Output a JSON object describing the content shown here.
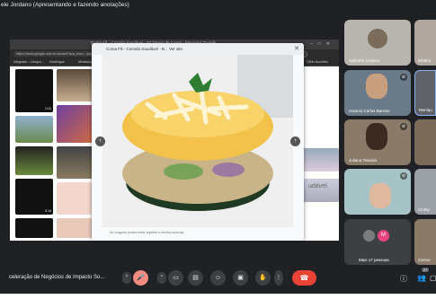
{
  "window": {
    "presenter_label": "ele Jordano (Apresentando e fazendo anotações)"
  },
  "browser": {
    "tab_title": "Coma Fã - Comida Saudável - 50 Dispar de Coma - Pesquisa Google",
    "url": "https://www.google.com.br/search?sca_esv=...&q=comida+saudavel&tbm=isch&sa=X&ved=2ahUKEwj...",
    "update_label": "Update",
    "bookmarks": [
      "Integrator – Integra...",
      "Novilingue",
      "WhatsApp",
      "Home – Canva",
      "ONE | TECH YOUNG...",
      "Dashboard | Hora...",
      "YouT | Conect: aftos...",
      "Other favorites"
    ]
  },
  "viewer": {
    "title": "Coma Fã - Comida Saudável - B...  Ver site",
    "footer": "As imagens podem estar sujeitas a direitos autorais.",
    "close": "✕",
    "prev": "‹",
    "next": "›"
  },
  "gallery": {
    "durations": [
      "0:11",
      "0:16",
      "0:14"
    ]
  },
  "side_text": "udável",
  "participants": [
    {
      "name": "Gabriele Jordano",
      "muted": false
    },
    {
      "name": "Antonio Carlos Barreto",
      "muted": true
    },
    {
      "name": "Juliana Teixeira",
      "muted": true
    },
    {
      "name": "",
      "muted": false
    },
    {
      "name": "Mais 17 pessoas",
      "muted": false
    }
  ],
  "edge_tiles": [
    "Bettina",
    "Moniqu",
    "",
    "Cinthy",
    "Carmo"
  ],
  "more_initial": "M",
  "meeting_title": "celeração de Negócios de Impacto So...",
  "people_count": "27",
  "colors": {
    "background": "#202124",
    "tile": "#3c4043",
    "hangup": "#ea4335",
    "more_avatar": "#e8447b"
  },
  "icons": [
    "chevron-up-icon",
    "mic-off-icon",
    "camera-icon",
    "captions-icon",
    "emoji-icon",
    "present-icon",
    "raise-hand-icon",
    "more-vert-icon",
    "hangup-icon",
    "info-icon",
    "people-icon",
    "chat-icon"
  ]
}
